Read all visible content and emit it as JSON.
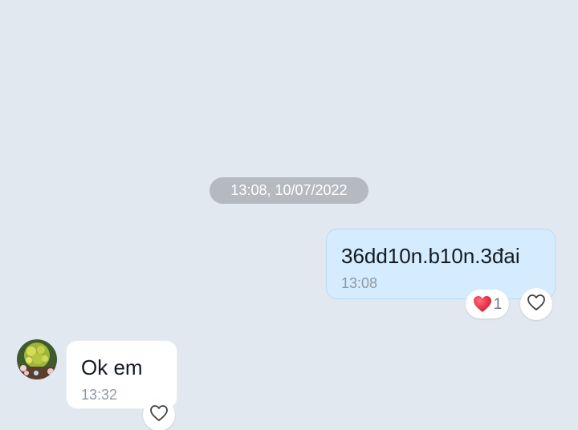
{
  "timeline": {
    "date_separator": "13:08, 10/07/2022"
  },
  "messages": [
    {
      "direction": "outgoing",
      "text": "36dd10n.b10n.3đai",
      "time": "13:08",
      "reaction": {
        "icon": "red-heart-icon",
        "count": "1"
      },
      "react_icon": "heart-outline-icon"
    },
    {
      "direction": "incoming",
      "text": "Ok em",
      "time": "13:32",
      "sender_avatar": "avatar-flowers",
      "react_icon": "heart-outline-icon"
    }
  ],
  "colors": {
    "background": "#e2e8f0",
    "outgoing_bubble": "#d4ecfe",
    "incoming_bubble": "#ffffff",
    "date_pill": "#b5bac1",
    "reaction_heart": "#e0213a"
  }
}
